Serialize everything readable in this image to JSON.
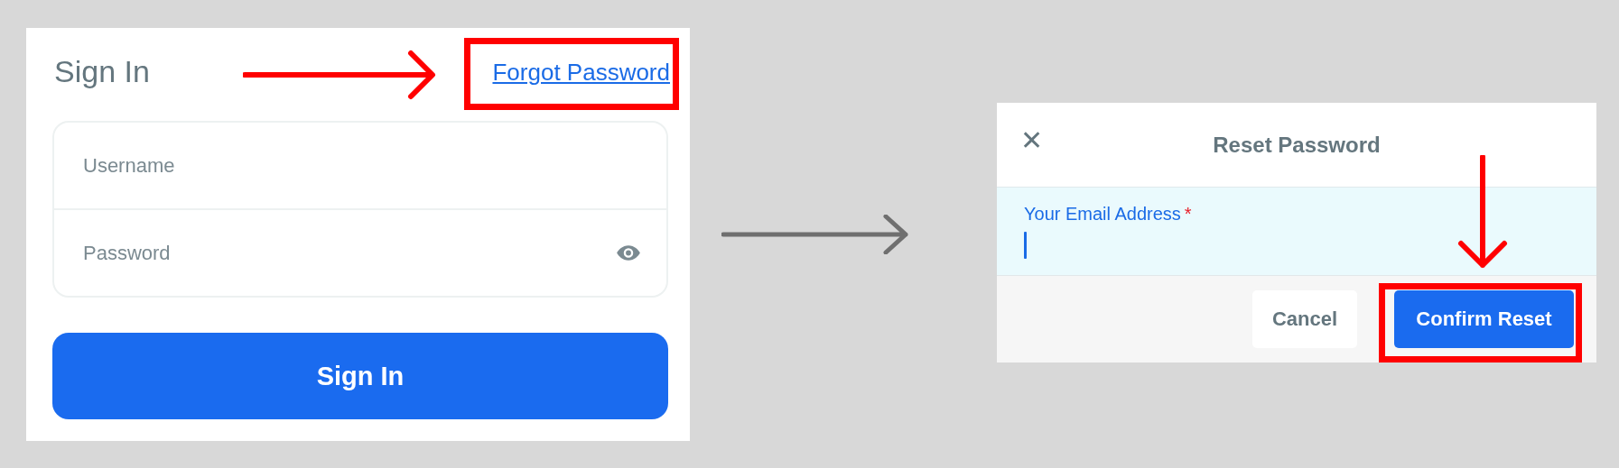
{
  "sign_in": {
    "title": "Sign In",
    "forgot_link": "Forgot Password",
    "fields": [
      {
        "placeholder": "Username",
        "kind": "text"
      },
      {
        "placeholder": "Password",
        "kind": "password"
      }
    ],
    "submit_button": "Sign In"
  },
  "reset_dialog": {
    "close_icon": "✕",
    "title": "Reset Password",
    "email_field": {
      "label": "Your Email Address",
      "required_mark": "*",
      "focused": true
    },
    "buttons": [
      {
        "label": "Cancel",
        "kind": "secondary"
      },
      {
        "label": "Confirm Reset",
        "kind": "primary"
      }
    ]
  }
}
